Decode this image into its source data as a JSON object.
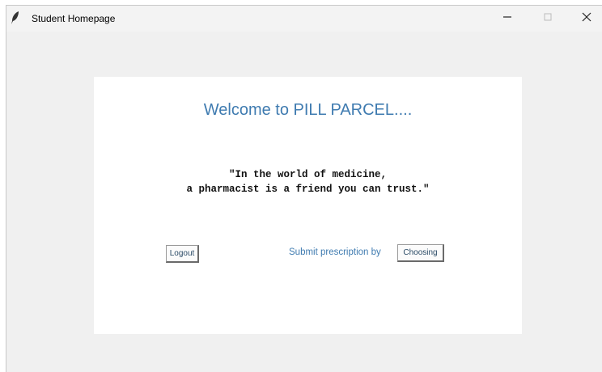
{
  "window": {
    "title": "Student Homepage",
    "icons": {
      "app": "feather-icon",
      "minimize": "minimize-icon",
      "maximize": "maximize-icon",
      "close": "close-icon"
    }
  },
  "content": {
    "welcome": "Welcome to PILL PARCEL....",
    "quote_line1": "\"In the world of medicine,",
    "quote_line2": "a pharmacist is a friend you can trust.\"",
    "logout_label": "Logout",
    "submit_label": "Submit prescription by",
    "choosing_label": "Choosing"
  },
  "colors": {
    "accent_text": "#3f7bb0",
    "window_bg": "#f0f0f0",
    "panel_bg": "#ffffff"
  }
}
